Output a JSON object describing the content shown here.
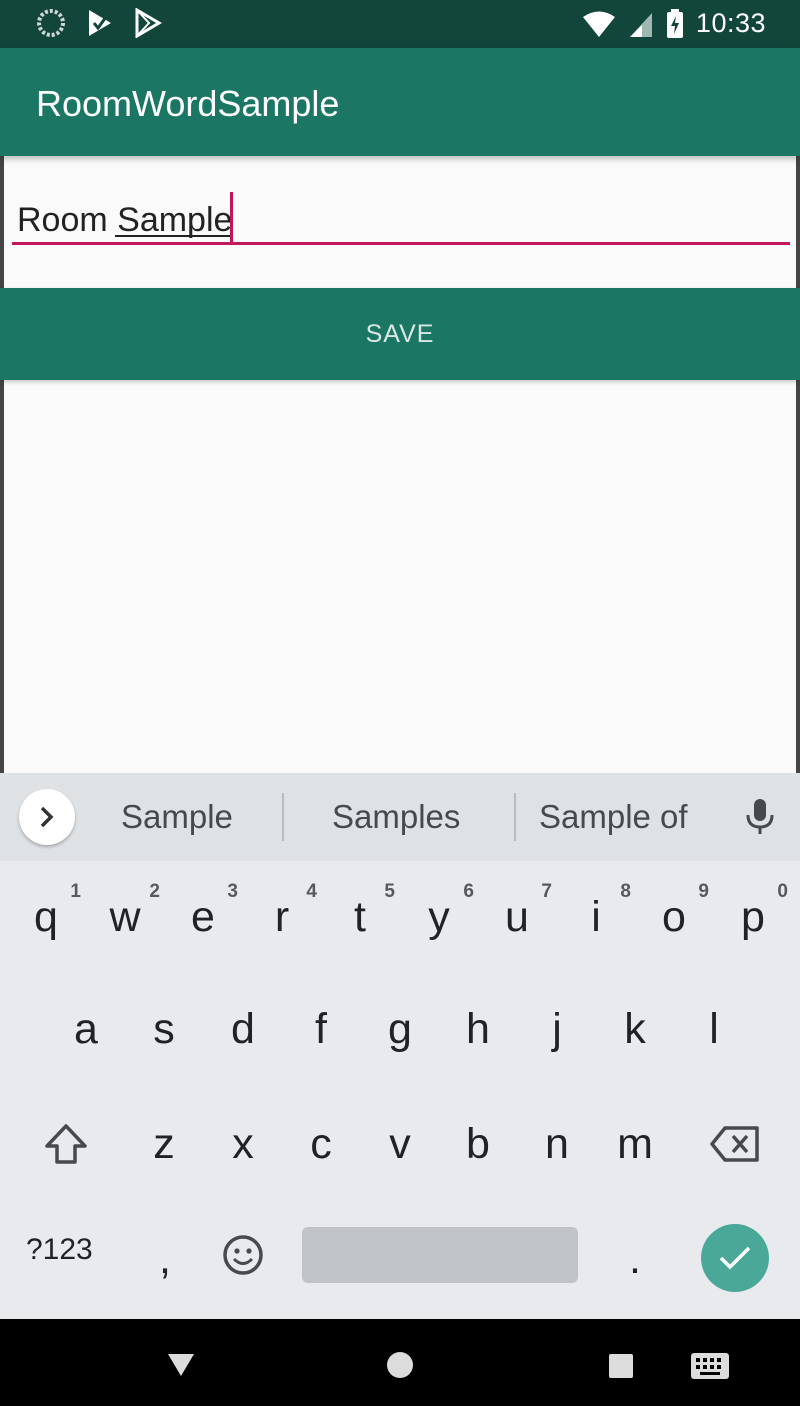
{
  "status_bar": {
    "time": "10:33",
    "icons": [
      "loading-icon",
      "play-store-check-icon",
      "play-store-icon",
      "wifi-icon",
      "signal-icon",
      "battery-charging-icon"
    ]
  },
  "app_bar": {
    "title": "RoomWordSample"
  },
  "input": {
    "value": "Room Sample"
  },
  "save_button": {
    "label": "SAVE"
  },
  "keyboard": {
    "suggestions": [
      "Sample",
      "Samples",
      "Sample of"
    ],
    "row1": [
      {
        "key": "q",
        "num": "1"
      },
      {
        "key": "w",
        "num": "2"
      },
      {
        "key": "e",
        "num": "3"
      },
      {
        "key": "r",
        "num": "4"
      },
      {
        "key": "t",
        "num": "5"
      },
      {
        "key": "y",
        "num": "6"
      },
      {
        "key": "u",
        "num": "7"
      },
      {
        "key": "i",
        "num": "8"
      },
      {
        "key": "o",
        "num": "9"
      },
      {
        "key": "p",
        "num": "0"
      }
    ],
    "row2": [
      "a",
      "s",
      "d",
      "f",
      "g",
      "h",
      "j",
      "k",
      "l"
    ],
    "row3": [
      "z",
      "x",
      "c",
      "v",
      "b",
      "n",
      "m"
    ],
    "symbols_label": "?123",
    "comma": ",",
    "period": ".",
    "accent_color": "#4aa899"
  },
  "colors": {
    "primary": "#1b7664",
    "primary_dark": "#12463b",
    "accent": "#c2185b"
  }
}
